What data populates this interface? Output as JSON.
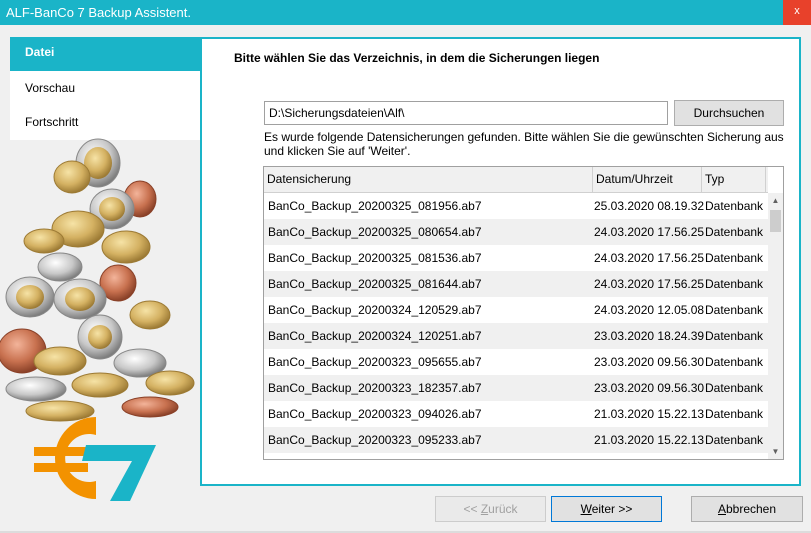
{
  "window": {
    "title": "ALF-BanCo 7 Backup Assistent.",
    "close_label": "x"
  },
  "sidebar": {
    "items": [
      {
        "label": "Datei",
        "active": true
      },
      {
        "label": "Vorschau",
        "active": false
      },
      {
        "label": "Fortschritt",
        "active": false
      }
    ]
  },
  "main": {
    "heading": "Bitte wählen Sie das Verzeichnis, in dem die Sicherungen liegen",
    "path_value": "D:\\Sicherungsdateien\\Alf\\",
    "browse_label": "Durchsuchen",
    "info_text": "Es wurde folgende Datensicherungen gefunden. Bitte wählen Sie die gewünschten Sicherung aus und klicken Sie auf 'Weiter'.",
    "table": {
      "columns": [
        "Datensicherung",
        "Datum/Uhrzeit",
        "Typ"
      ],
      "rows": [
        [
          "BanCo_Backup_20200325_081956.ab7",
          "25.03.2020 08.19.32",
          "Datenbank"
        ],
        [
          "BanCo_Backup_20200325_080654.ab7",
          "24.03.2020 17.56.25",
          "Datenbank"
        ],
        [
          "BanCo_Backup_20200325_081536.ab7",
          "24.03.2020 17.56.25",
          "Datenbank"
        ],
        [
          "BanCo_Backup_20200325_081644.ab7",
          "24.03.2020 17.56.25",
          "Datenbank"
        ],
        [
          "BanCo_Backup_20200324_120529.ab7",
          "24.03.2020 12.05.08",
          "Datenbank"
        ],
        [
          "BanCo_Backup_20200324_120251.ab7",
          "23.03.2020 18.24.39",
          "Datenbank"
        ],
        [
          "BanCo_Backup_20200323_095655.ab7",
          "23.03.2020 09.56.30",
          "Datenbank"
        ],
        [
          "BanCo_Backup_20200323_182357.ab7",
          "23.03.2020 09.56.30",
          "Datenbank"
        ],
        [
          "BanCo_Backup_20200323_094026.ab7",
          "21.03.2020 15.22.13",
          "Datenbank"
        ],
        [
          "BanCo_Backup_20200323_095233.ab7",
          "21.03.2020 15.22.13",
          "Datenbank"
        ]
      ]
    }
  },
  "buttons": {
    "back_prefix": "<< ",
    "back_hotkey": "Z",
    "back_rest": "urück",
    "next_hotkey": "W",
    "next_rest": "eiter >>",
    "cancel_hotkey": "A",
    "cancel_rest": "bbrechen"
  },
  "colors": {
    "accent": "#1ab4c8",
    "close": "#e8412b",
    "logo_orange": "#f39200",
    "logo_teal": "#1ab4c8"
  },
  "icons": {
    "close": "close-icon",
    "scroll_up": "chevron-up-icon",
    "scroll_down": "chevron-down-icon",
    "logo": "euro-7-logo"
  }
}
